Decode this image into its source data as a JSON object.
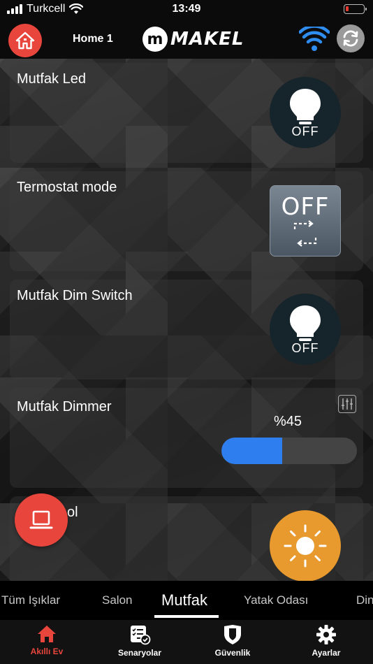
{
  "status": {
    "carrier": "Turkcell",
    "time": "13:49"
  },
  "header": {
    "home_name": "Home 1",
    "logo_mark": "m",
    "logo_text": "MAKEL"
  },
  "devices": [
    {
      "title": "Mutfak Led",
      "type": "bulb",
      "state": "OFF"
    },
    {
      "title": "Termostat mode",
      "type": "thermostat",
      "state": "OFF"
    },
    {
      "title": "Mutfak Dim Switch",
      "type": "bulb",
      "state": "OFF"
    },
    {
      "title": "Mutfak Dimmer",
      "type": "dimmer",
      "value_label": "%45",
      "level": 0.45
    },
    {
      "title": "ol",
      "type": "sun"
    }
  ],
  "room_tabs": [
    "Tüm Işıklar",
    "Salon",
    "Mutfak",
    "Yatak Odası",
    "Din"
  ],
  "active_room_tab": "Mutfak",
  "bottom_nav": [
    {
      "label": "Akıllı Ev",
      "icon": "home-icon",
      "active": true
    },
    {
      "label": "Senaryolar",
      "icon": "scenario-checklist-icon",
      "active": false
    },
    {
      "label": "Güvenlik",
      "icon": "shield-icon",
      "active": false
    },
    {
      "label": "Ayarlar",
      "icon": "gear-icon",
      "active": false
    }
  ],
  "colors": {
    "accent_red": "#e8453c",
    "slider_blue": "#2e7ef0",
    "sun_orange": "#e89a2e",
    "wifi_blue": "#2f8df0"
  }
}
